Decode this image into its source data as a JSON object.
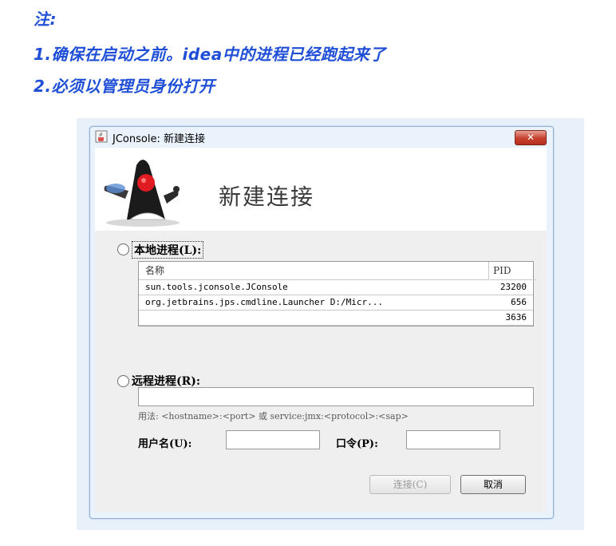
{
  "notes": {
    "title": "注:",
    "line1": "1.确保在启动之前。idea中的进程已经跑起来了",
    "line2": "2.必须以管理员身份打开"
  },
  "window": {
    "title": "JConsole: 新建连接",
    "close_label": "✕"
  },
  "dialog": {
    "heading": "新建连接"
  },
  "local": {
    "label": "本地进程(L):",
    "columns": {
      "name": "名称",
      "pid": "PID"
    },
    "rows": [
      {
        "name": "sun.tools.jconsole.JConsole",
        "pid": "23200"
      },
      {
        "name": "org.jetbrains.jps.cmdline.Launcher D:/Micr...",
        "pid": "656"
      },
      {
        "name": "",
        "pid": "3636"
      }
    ]
  },
  "remote": {
    "label": "远程进程(R):",
    "value": "",
    "usage": "用法: <hostname>:<port> 或 service:jmx:<protocol>:<sap>"
  },
  "auth": {
    "username_label": "用户名(U):",
    "username_value": "",
    "password_label": "口令(P):",
    "password_value": ""
  },
  "buttons": {
    "connect": "连接(C)",
    "cancel": "取消"
  }
}
